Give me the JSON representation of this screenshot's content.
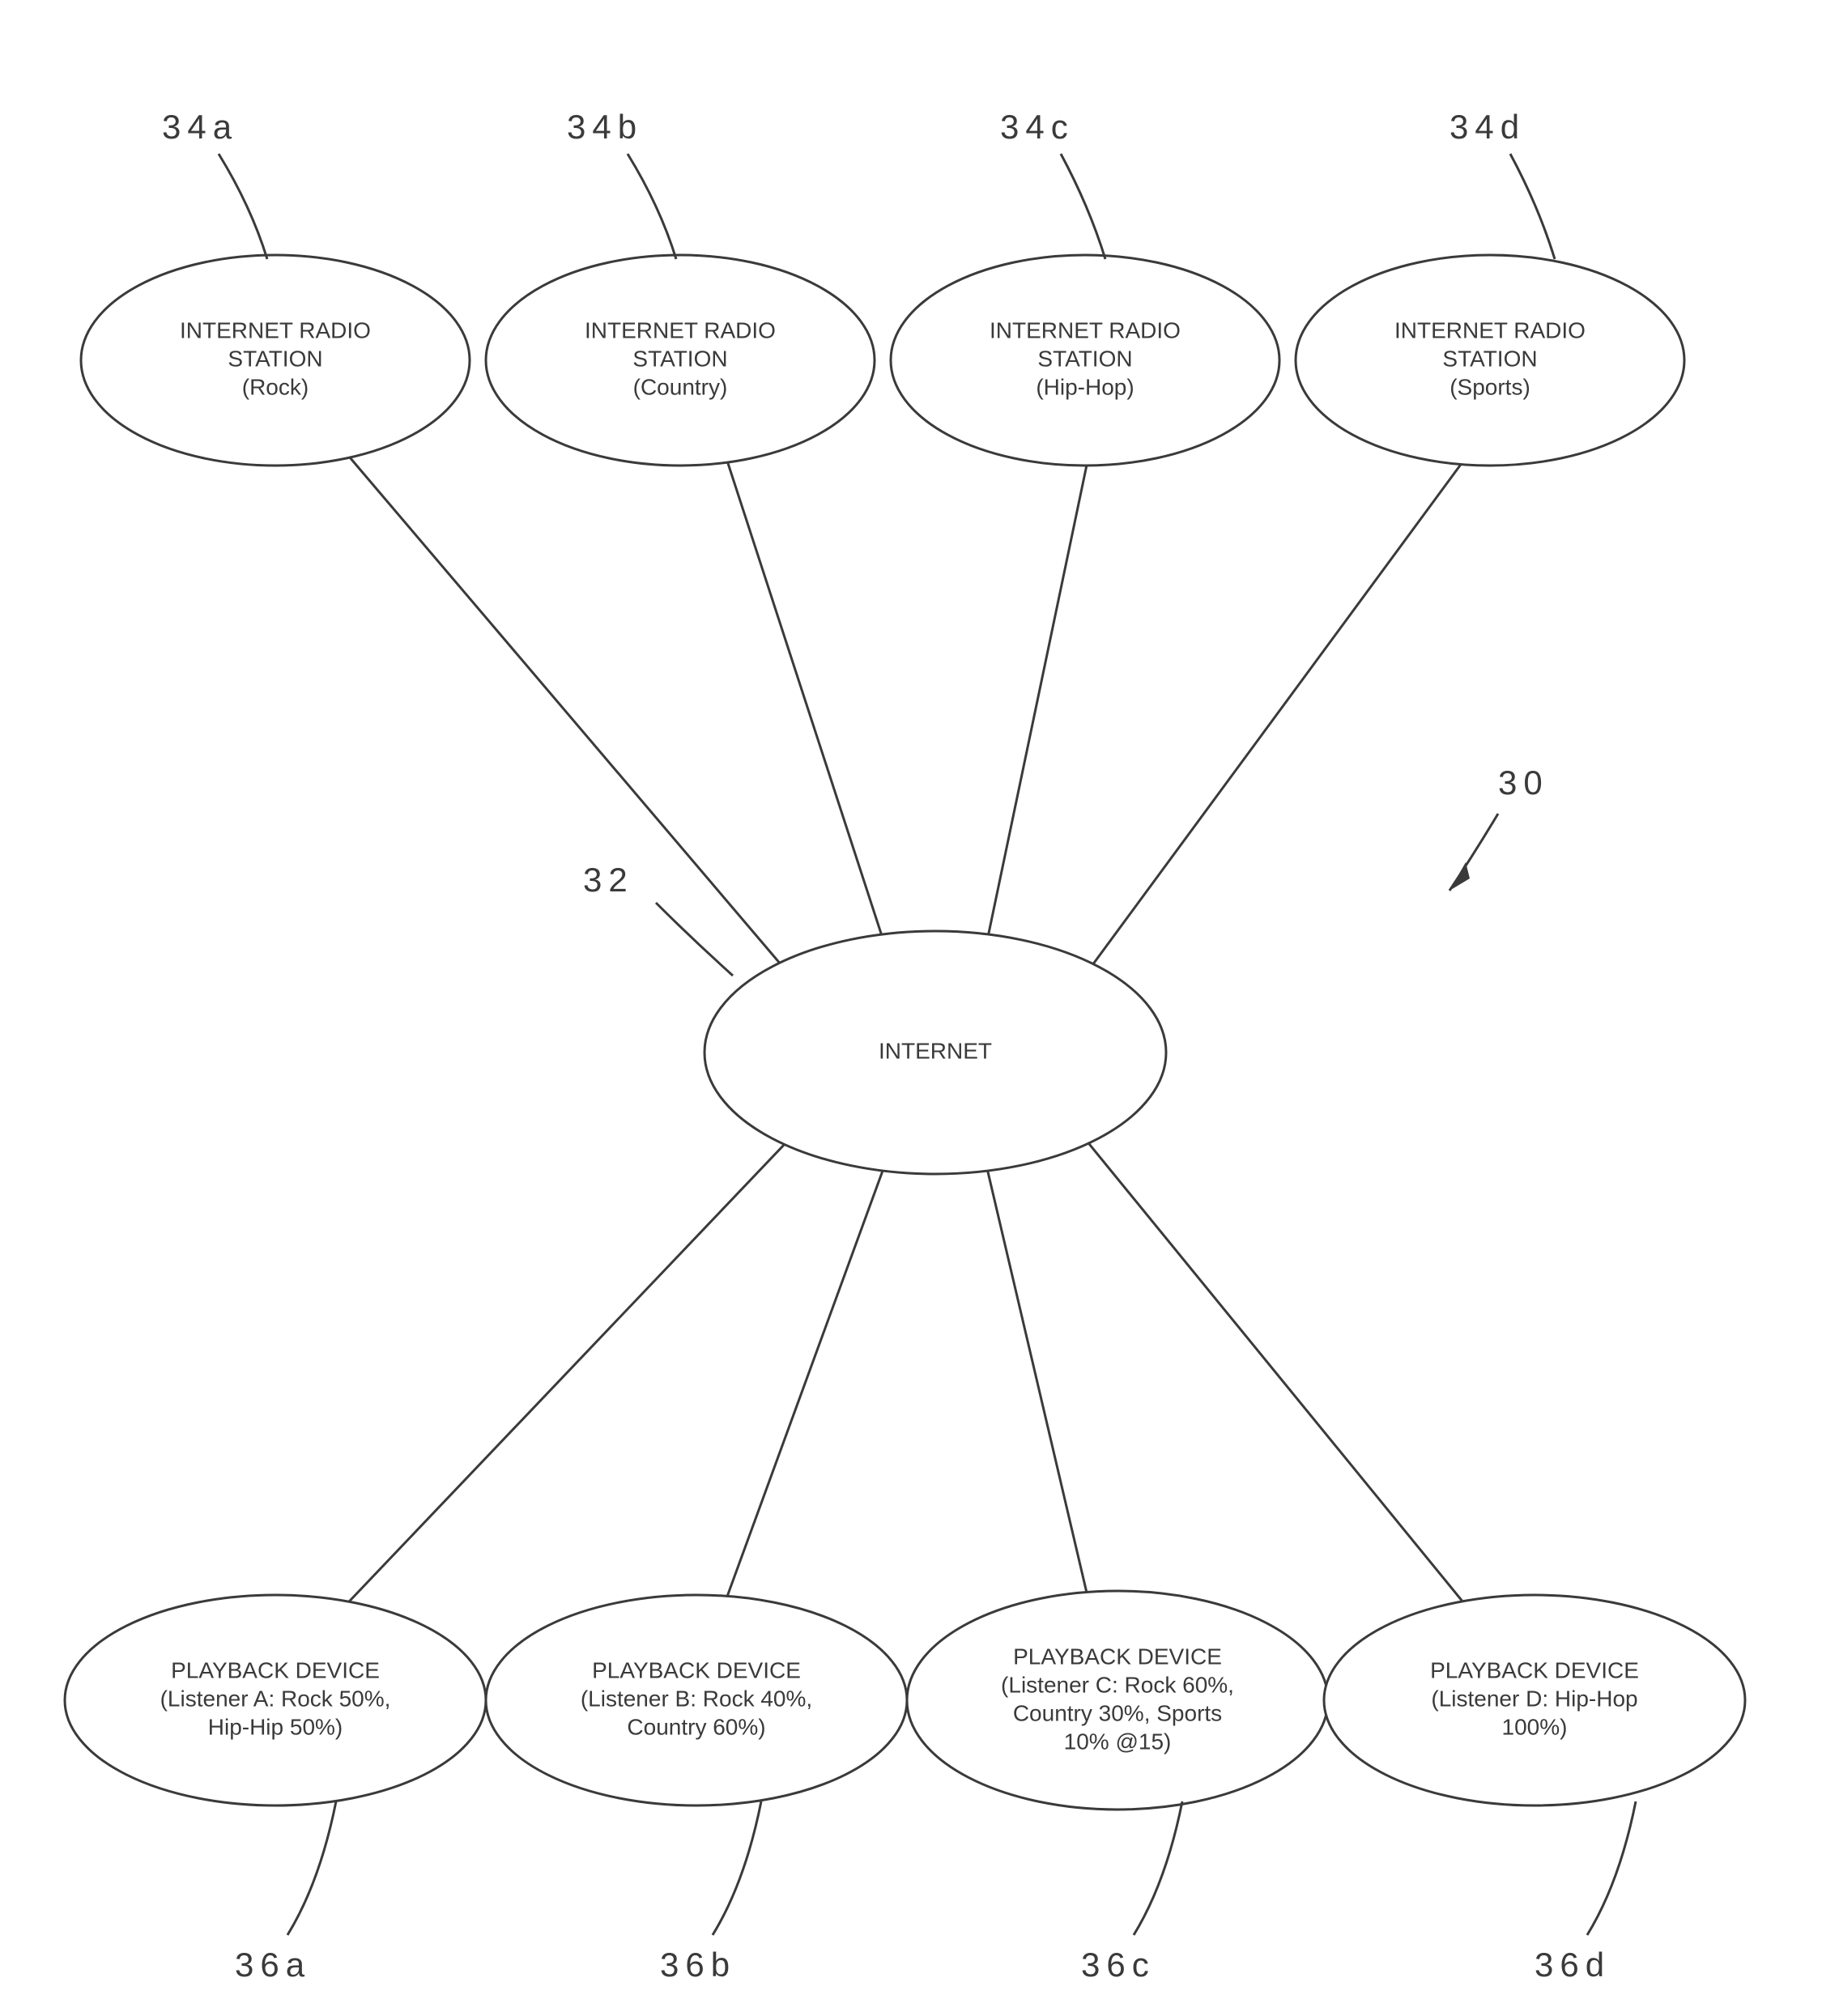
{
  "nodes": {
    "station_a": {
      "line1": "INTERNET RADIO",
      "line2": "STATION",
      "line3": "(Rock)"
    },
    "station_b": {
      "line1": "INTERNET RADIO",
      "line2": "STATION",
      "line3": "(Country)"
    },
    "station_c": {
      "line1": "INTERNET RADIO",
      "line2": "STATION",
      "line3": "(Hip-Hop)"
    },
    "station_d": {
      "line1": "INTERNET RADIO",
      "line2": "STATION",
      "line3": "(Sports)"
    },
    "internet": {
      "line1": "INTERNET"
    },
    "device_a": {
      "line1": "PLAYBACK DEVICE",
      "line2": "(Listener A: Rock 50%,",
      "line3": "Hip-Hip 50%)"
    },
    "device_b": {
      "line1": "PLAYBACK DEVICE",
      "line2": "(Listener B: Rock 40%,",
      "line3": "Country 60%)"
    },
    "device_c": {
      "line1": "PLAYBACK DEVICE",
      "line2": "(Listener C: Rock 60%,",
      "line3": "Country 30%, Sports",
      "line4": "10% @15)"
    },
    "device_d": {
      "line1": "PLAYBACK DEVICE",
      "line2": "(Listener D:  Hip-Hop",
      "line3": "100%)"
    }
  },
  "labels": {
    "l34a": "34a",
    "l34b": "34b",
    "l34c": "34c",
    "l34d": "34d",
    "l32": "32",
    "l30": "30",
    "l36a": "36a",
    "l36b": "36b",
    "l36c": "36c",
    "l36d": "36d"
  }
}
